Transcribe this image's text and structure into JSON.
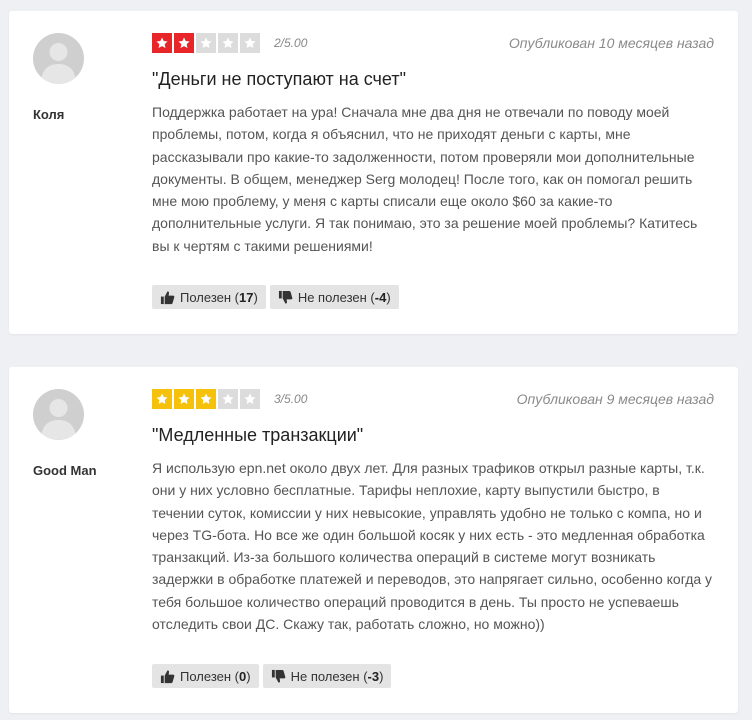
{
  "colors": {
    "star_low": "#e8262a",
    "star_mid": "#f5c10a",
    "star_empty": "#dcdcdc",
    "page_bg": "#eef0f3"
  },
  "reviews": [
    {
      "author": "Коля",
      "rating": 2,
      "max_rating": 5,
      "rating_text": "2/5.00",
      "published": "Опубликован 10 месяцев назад",
      "title": "\"Деньги не поступают на счет\"",
      "body": "Поддержка работает на ура! Сначала мне два дня не отвечали по поводу моей проблемы, потом, когда я объяснил, что не приходят деньги с карты, мне рассказывали про какие-то задолженности, потом проверяли мои дополнительные документы. В общем, менеджер Serg молодец! После того, как он помогал решить мне мою проблему, у меня с карты списали еще около $60 за какие-то дополнительные услуги. Я так понимаю, это за решение моей проблемы? Катитесь вы к чертям с такими решениями!",
      "helpful_label": "Полезен",
      "helpful_open": "(",
      "helpful_count": "17",
      "helpful_close": ")",
      "not_helpful_label": "Не полезен",
      "not_helpful_open": "(",
      "not_helpful_count": "-4",
      "not_helpful_close": ")"
    },
    {
      "author": "Good Man",
      "rating": 3,
      "max_rating": 5,
      "rating_text": "3/5.00",
      "published": "Опубликован 9 месяцев назад",
      "title": "\"Медленные транзакции\"",
      "body": "Я использую epn.net около двух лет. Для разных трафиков открыл разные карты, т.к. они у них условно бесплатные. Тарифы неплохие, карту выпустили быстро, в течении суток, комиссии у них невысокие, управлять удобно не только с компа, но и через TG-бота. Но все же один большой косяк у них есть - это медленная обработка транзакций. Из-за большого количества операций в системе могут возникать задержки в обработке платежей и переводов, это напрягает сильно, особенно когда у тебя большое количество операций проводится в день. Ты просто не успеваешь отследить свои ДС. Скажу так, работать сложно, но можно))",
      "helpful_label": "Полезен",
      "helpful_open": "(",
      "helpful_count": "0",
      "helpful_close": ")",
      "not_helpful_label": "Не полезен",
      "not_helpful_open": "(",
      "not_helpful_count": "-3",
      "not_helpful_close": ")"
    }
  ]
}
